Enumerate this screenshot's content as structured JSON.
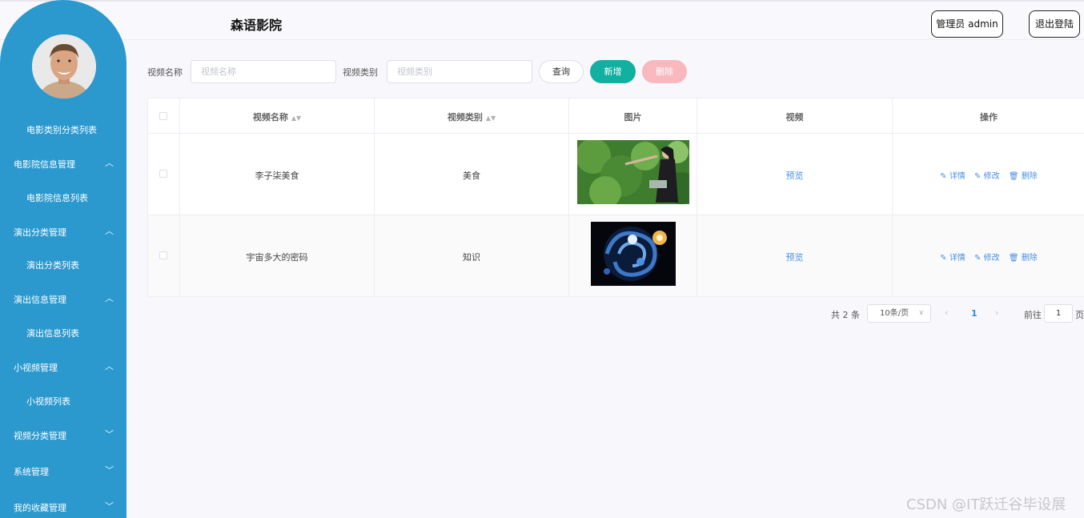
{
  "header": {
    "title": "森语影院",
    "admin_label": "管理员 admin",
    "logout_label": "退出登陆"
  },
  "sidebar": {
    "partial_item": "电影类别分类列表",
    "items": [
      {
        "label": "电影院信息管理",
        "type": "group",
        "expanded": true
      },
      {
        "label": "电影院信息列表",
        "type": "sub"
      },
      {
        "label": "演出分类管理",
        "type": "group",
        "expanded": true
      },
      {
        "label": "演出分类列表",
        "type": "sub"
      },
      {
        "label": "演出信息管理",
        "type": "group",
        "expanded": true
      },
      {
        "label": "演出信息列表",
        "type": "sub"
      },
      {
        "label": "小视频管理",
        "type": "group",
        "expanded": true
      },
      {
        "label": "小视频列表",
        "type": "sub"
      },
      {
        "label": "视频分类管理",
        "type": "group",
        "expanded": false
      },
      {
        "label": "系统管理",
        "type": "group",
        "expanded": false
      },
      {
        "label": "我的收藏管理",
        "type": "group",
        "expanded": false
      }
    ]
  },
  "search": {
    "name_label": "视频名称",
    "name_placeholder": "视频名称",
    "category_label": "视频类别",
    "category_placeholder": "视频类别",
    "query_button": "查询",
    "add_button": "新增",
    "delete_button": "删除"
  },
  "table": {
    "columns": [
      "视频名称",
      "视频类别",
      "图片",
      "视频",
      "操作"
    ],
    "rows": [
      {
        "name": "李子柒美食",
        "category": "美食",
        "video": "预览",
        "image": "woman-in-garden-photo"
      },
      {
        "name": "宇宙多大的密码",
        "category": "知识",
        "video": "预览",
        "image": "galaxy-swirl-photo"
      }
    ],
    "actions": {
      "detail": "详情",
      "edit": "修改",
      "delete": "删除"
    }
  },
  "pagination": {
    "total": "共 2 条",
    "page_size": "10条/页",
    "current_page": "1",
    "goto_label": "前往",
    "goto_value": "1",
    "page_suffix": "页"
  },
  "watermark": "CSDN @IT跃迁谷毕设展",
  "colors": {
    "sidebar": "#2b99ce",
    "add_button": "#12b0a0",
    "delete_button": "#f9b8be",
    "link": "#4a90e2"
  }
}
